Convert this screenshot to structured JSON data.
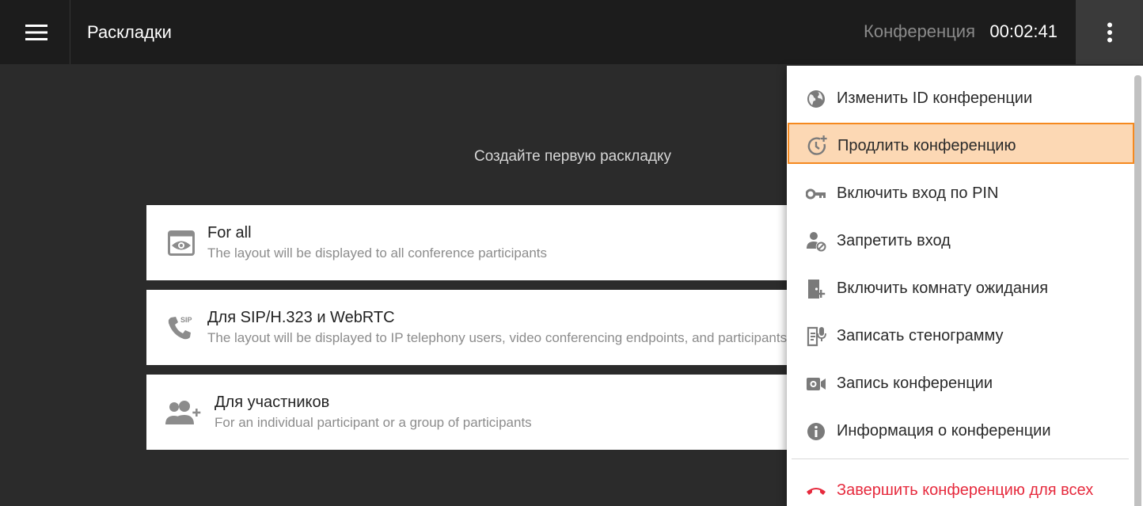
{
  "header": {
    "title": "Раскладки",
    "conference_label": "Конференция",
    "timer": "00:02:41"
  },
  "main": {
    "empty_title": "Создайте первую раскладку",
    "cards": [
      {
        "title": "For all",
        "desc": "The layout will be displayed to all conference participants",
        "icon": "eye-window-icon"
      },
      {
        "title": "Для SIP/H.323 и WebRTC",
        "desc": "The layout will be displayed to IP telephony users, video conferencing endpoints, and participants",
        "icon": "sip-phone-icon"
      },
      {
        "title": "Для участников",
        "desc": "For an individual participant or a group of participants",
        "icon": "add-group-icon"
      }
    ]
  },
  "menu": {
    "items": [
      {
        "label": "Изменить ID конференции",
        "icon": "globe-icon"
      },
      {
        "label": "Продлить конференцию",
        "icon": "clock-plus-icon",
        "selected": true
      },
      {
        "label": "Включить вход по PIN",
        "icon": "key-icon"
      },
      {
        "label": "Запретить вход",
        "icon": "person-block-icon"
      },
      {
        "label": "Включить комнату ожидания",
        "icon": "door-plus-icon"
      },
      {
        "label": "Записать стенограмму",
        "icon": "transcript-icon"
      },
      {
        "label": "Запись конференции",
        "icon": "video-camera-icon"
      },
      {
        "label": "Информация о конференции",
        "icon": "info-icon"
      },
      {
        "label": "Завершить конференцию для всех",
        "icon": "hangup-icon",
        "danger": true
      }
    ]
  },
  "colors": {
    "accent": "#f5891f",
    "selected_bg": "#fcd8b4",
    "danger": "#e62a3d",
    "header_bg": "#1c1c1c",
    "page_bg": "#2b2b2b"
  }
}
